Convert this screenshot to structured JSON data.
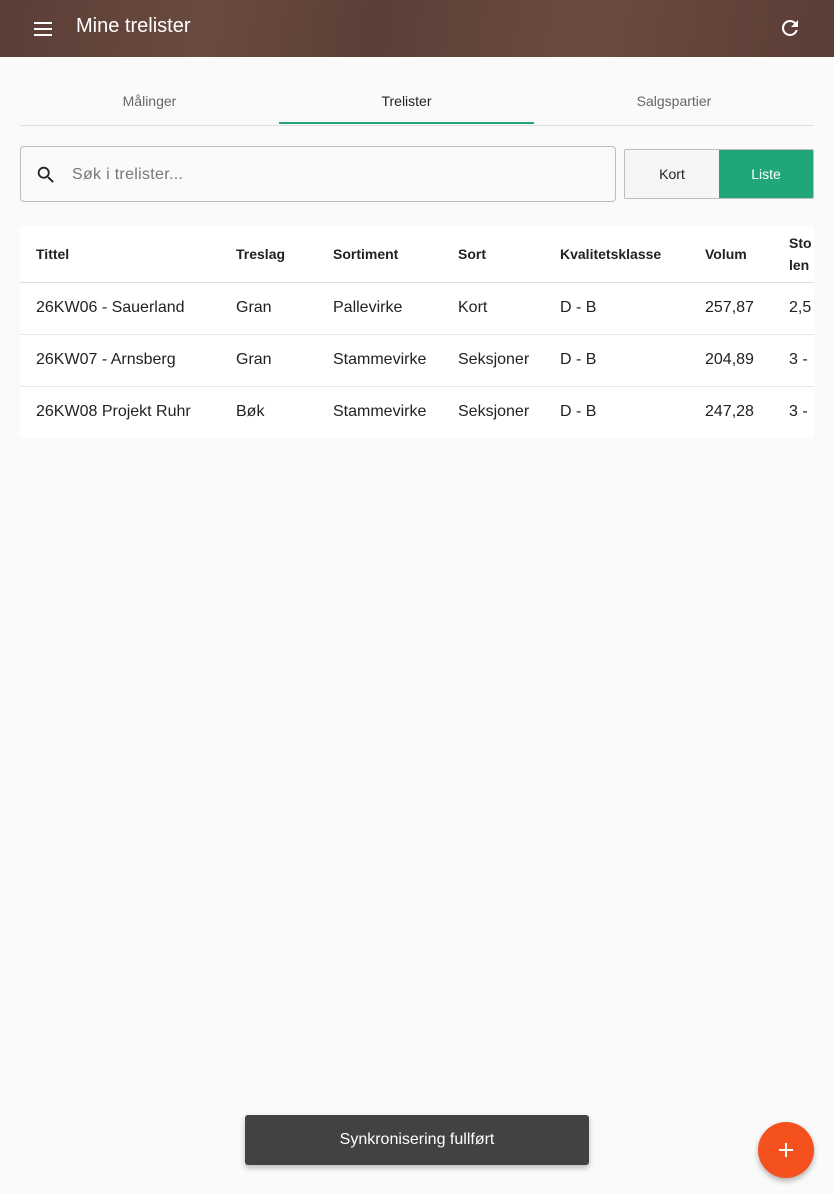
{
  "appbar": {
    "title": "Mine trelister"
  },
  "tabs": [
    {
      "label": "Målinger"
    },
    {
      "label": "Trelister"
    },
    {
      "label": "Salgspartier"
    }
  ],
  "search": {
    "placeholder": "Søk i trelister..."
  },
  "view_toggle": {
    "card_label": "Kort",
    "list_label": "Liste",
    "selected": "Liste"
  },
  "table": {
    "headers": [
      "Tittel",
      "Treslag",
      "Sortiment",
      "Sort",
      "Kvalitetsklasse",
      "Volum",
      "Sto\nlen"
    ],
    "rows": [
      [
        "26KW06 - Sauerland",
        "Gran",
        "Pallevirke",
        "Kort",
        "D - B",
        "257,87",
        "2,5"
      ],
      [
        "26KW07 - Arnsberg",
        "Gran",
        "Stammevirke",
        "Seksjoner",
        "D - B",
        "204,89",
        "3 -"
      ],
      [
        "26KW08 Projekt Ruhr",
        "Bøk",
        "Stammevirke",
        "Seksjoner",
        "D - B",
        "247,28",
        "3 -"
      ]
    ]
  },
  "snackbar": {
    "message": "Synkronisering fullført"
  },
  "colors": {
    "accent": "#21a67a",
    "appbar": "#5e4138",
    "fab": "#f4511e"
  },
  "icons": {
    "menu": "menu-icon",
    "refresh": "refresh-icon",
    "search": "search-icon",
    "add": "add-icon"
  }
}
